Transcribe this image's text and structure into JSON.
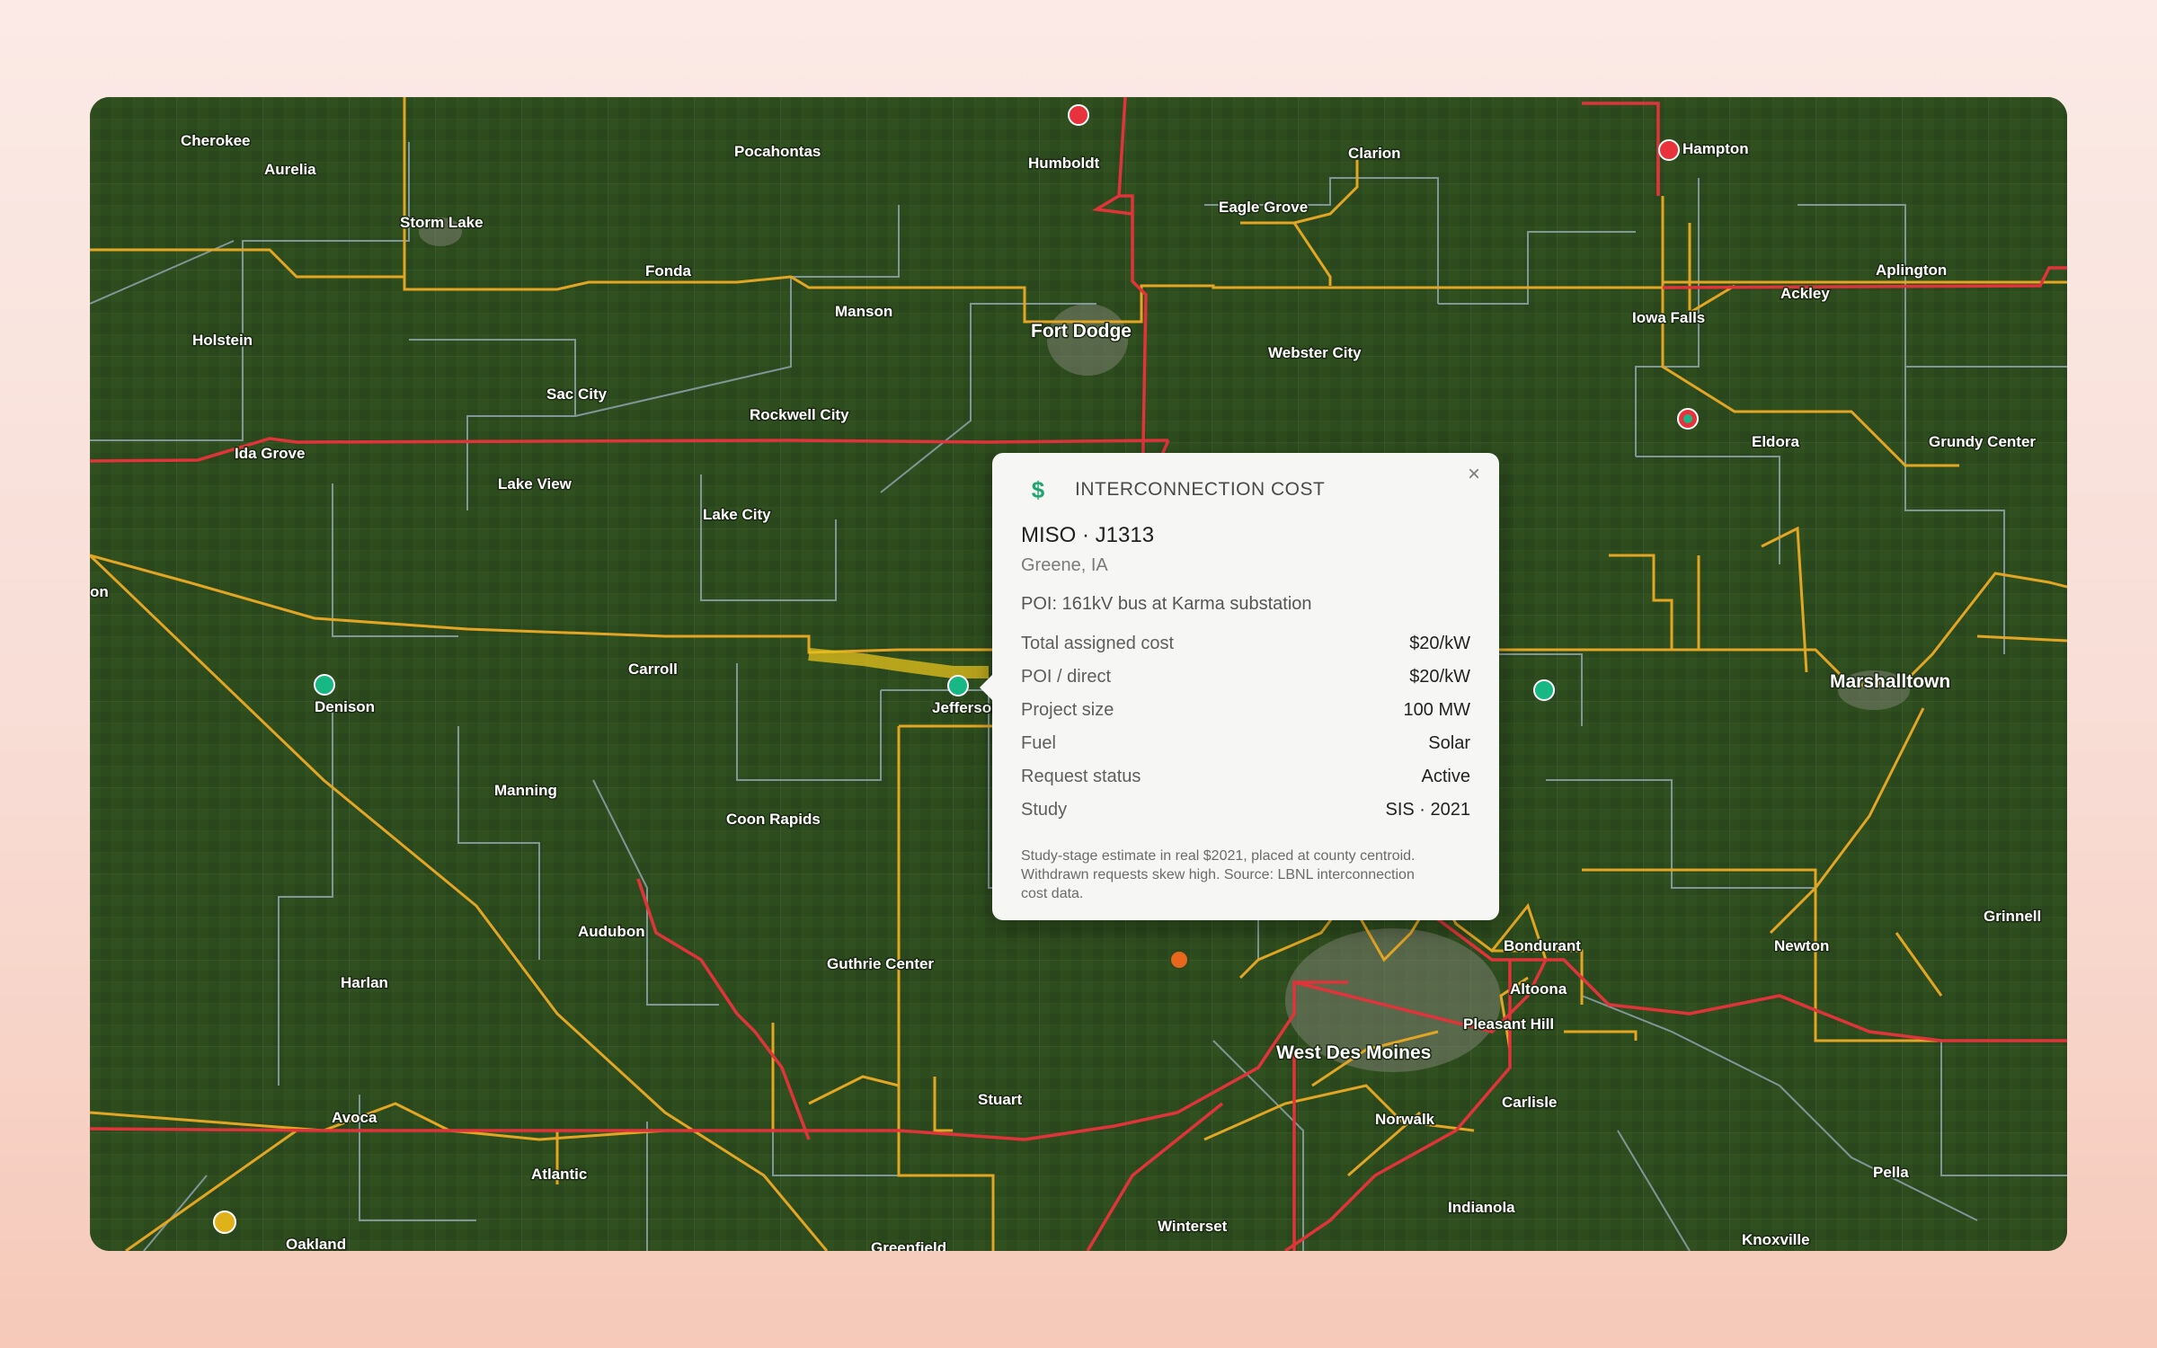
{
  "map": {
    "labels": {
      "cherokee": "Cherokee",
      "aurelia": "Aurelia",
      "pocahontas": "Pocahontas",
      "humboldt": "Humboldt",
      "clarion": "Clarion",
      "hampton": "Hampton",
      "storm_lake": "Storm Lake",
      "eagle_grove": "Eagle Grove",
      "fonda": "Fonda",
      "aplington": "Aplington",
      "ackley": "Ackley",
      "manson": "Manson",
      "fort_dodge": "Fort Dodge",
      "iowa_falls": "Iowa Falls",
      "holstein": "Holstein",
      "webster_city": "Webster City",
      "sac_city": "Sac City",
      "rockwell_city": "Rockwell City",
      "eldora": "Eldora",
      "grundy_center": "Grundy Center",
      "ida_grove": "Ida Grove",
      "lake_view": "Lake View",
      "lake_city": "Lake City",
      "on": "on",
      "carroll": "Carroll",
      "denison": "Denison",
      "jefferson": "Jefferson",
      "marshalltown": "Marshalltown",
      "manning": "Manning",
      "coon_rapids": "Coon Rapids",
      "grinnell": "Grinnell",
      "audubon": "Audubon",
      "bondurant": "Bondurant",
      "newton": "Newton",
      "guthrie_center": "Guthrie Center",
      "harlan": "Harlan",
      "altoona": "Altoona",
      "pleasant_hill": "Pleasant Hill",
      "west_des_moines": "West Des Moines",
      "avoca": "Avoca",
      "stuart": "Stuart",
      "carlisle": "Carlisle",
      "norwalk": "Norwalk",
      "atlantic": "Atlantic",
      "pella": "Pella",
      "indianola": "Indianola",
      "winterset": "Winterset",
      "oakland": "Oakland",
      "knoxville": "Knoxville",
      "greenfield": "Greenfield"
    },
    "markers": [
      {
        "name": "marker-red-humboldt",
        "color": "#e8323c"
      },
      {
        "name": "marker-red-hampton",
        "color": "#e8323c"
      },
      {
        "name": "marker-ring-eldora",
        "color": "#e8323c"
      },
      {
        "name": "marker-green-denison",
        "color": "#17b884"
      },
      {
        "name": "marker-green-jefferson",
        "color": "#17b884"
      },
      {
        "name": "marker-green-marshalltown",
        "color": "#17b884"
      },
      {
        "name": "marker-orange",
        "color": "#e8671c"
      },
      {
        "name": "marker-yellow-oakland",
        "color": "#e0b21a"
      }
    ],
    "colors": {
      "land": "#2c4a1d",
      "line_345kv": "#e0343a",
      "line_161kv": "#e3a624",
      "line_other": "#8fa3ad",
      "highlight": "#e7c21c"
    }
  },
  "popup": {
    "icon": "dollar-icon",
    "label": "INTERCONNECTION COST",
    "close": "×",
    "title": "MISO · J1313",
    "location": "Greene, IA",
    "poi": "POI: 161kV bus at Karma substation",
    "rows": [
      {
        "key": "Total assigned cost",
        "value": "$20/kW"
      },
      {
        "key": "POI / direct",
        "value": "$20/kW"
      },
      {
        "key": "Project size",
        "value": "100 MW"
      },
      {
        "key": "Fuel",
        "value": "Solar"
      },
      {
        "key": "Request status",
        "value": "Active"
      },
      {
        "key": "Study",
        "value": "SIS · 2021"
      }
    ],
    "note": "Study-stage estimate in real $2021, placed at county centroid. Withdrawn requests skew high. Source: LBNL interconnection cost data."
  }
}
